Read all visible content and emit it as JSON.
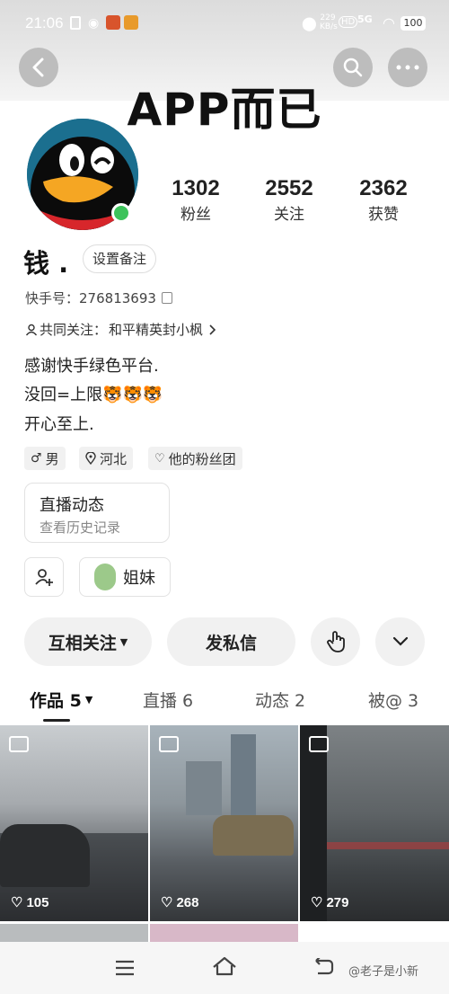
{
  "status_bar": {
    "time": "21:06",
    "speed": "229",
    "speed_unit": "KB/s",
    "hd": "HD",
    "network": "5G",
    "battery": "100"
  },
  "overlay_title": "APP而已",
  "profile": {
    "name": "钱 .",
    "remark_button": "设置备注",
    "id_label": "快手号：",
    "id_value": "276813693",
    "mutual_label": "共同关注：",
    "mutual_value": "和平精英封小枫",
    "bio": [
      "感谢快手绿色平台.",
      "没回=上限🐯🐯🐯",
      "开心至上."
    ],
    "tags": [
      "男",
      "河北",
      "他的粉丝团"
    ]
  },
  "stats": [
    {
      "value": "1302",
      "label": "粉丝"
    },
    {
      "value": "2552",
      "label": "关注"
    },
    {
      "value": "2362",
      "label": "获赞"
    }
  ],
  "live_card": {
    "title": "直播动态",
    "subtitle": "查看历史记录"
  },
  "sister_button": "姐妹",
  "actions": {
    "follow": "互相关注",
    "message": "发私信"
  },
  "tabs": [
    {
      "label": "作品 5"
    },
    {
      "label": "直播 6"
    },
    {
      "label": "动态 2"
    },
    {
      "label": "被@ 3"
    }
  ],
  "posts": [
    {
      "likes": "105"
    },
    {
      "likes": "268"
    },
    {
      "likes": "279"
    }
  ],
  "watermark": "@老子是小新",
  "colors": {
    "accent": "#222222",
    "online": "#3cc35a",
    "avatar_bg": "#1b6f8f"
  }
}
